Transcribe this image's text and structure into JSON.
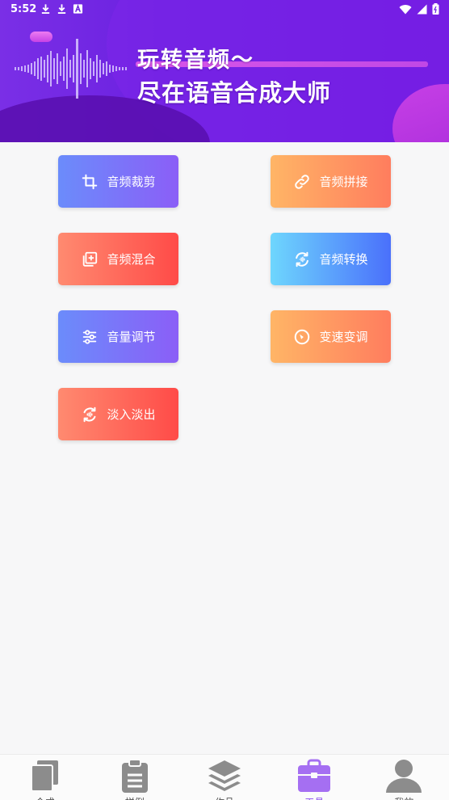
{
  "status_bar": {
    "time": "5:52"
  },
  "banner": {
    "line1": "玩转音频～",
    "line2": "尽在语音合成大师"
  },
  "tools": [
    {
      "label": "音频裁剪",
      "icon": "crop-icon"
    },
    {
      "label": "音频拼接",
      "icon": "link-icon"
    },
    {
      "label": "音频混合",
      "icon": "layers-plus-icon"
    },
    {
      "label": "音频转换",
      "icon": "convert-icon"
    },
    {
      "label": "音量调节",
      "icon": "sliders-icon"
    },
    {
      "label": "变速变调",
      "icon": "speed-icon"
    },
    {
      "label": "淡入淡出",
      "icon": "fade-icon"
    }
  ],
  "bottom_nav": [
    {
      "label": "合成",
      "icon": "copy-icon"
    },
    {
      "label": "样例",
      "icon": "clipboard-icon"
    },
    {
      "label": "作品",
      "icon": "layers-icon"
    },
    {
      "label": "工具",
      "icon": "toolbox-icon",
      "active": true
    },
    {
      "label": "我的",
      "icon": "person-icon"
    }
  ],
  "colors": {
    "banner_purple": "#6a1fe0",
    "active_nav": "#8a4cf0",
    "inactive_nav": "#8c8c8c"
  }
}
